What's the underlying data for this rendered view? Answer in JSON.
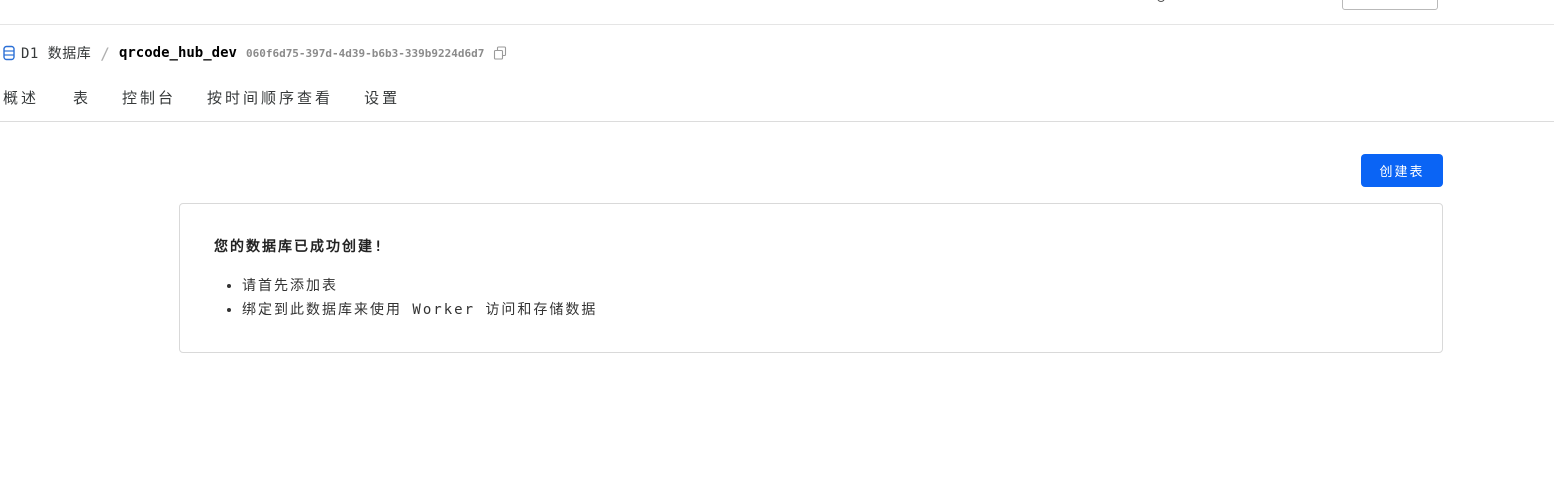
{
  "breadcrumb": {
    "root": "D1 数据库",
    "separator": "/",
    "database_name": "qrcode_hub_dev",
    "database_id": "060f6d75-397d-4d39-b6b3-339b9224d6d7"
  },
  "tabs": [
    {
      "label": "概述"
    },
    {
      "label": "表"
    },
    {
      "label": "控制台"
    },
    {
      "label": "按时间顺序查看"
    },
    {
      "label": "设置"
    }
  ],
  "actions": {
    "create_table_label": "创建表"
  },
  "empty_state": {
    "title": "您的数据库已成功创建!",
    "items": [
      "请首先添加表",
      "绑定到此数据库来使用 Worker 访问和存储数据"
    ]
  },
  "colors": {
    "accent": "#0a64f5",
    "db_icon": "#2a6fd6"
  },
  "icons": {
    "database": "database-icon",
    "copy": "copy-icon"
  }
}
